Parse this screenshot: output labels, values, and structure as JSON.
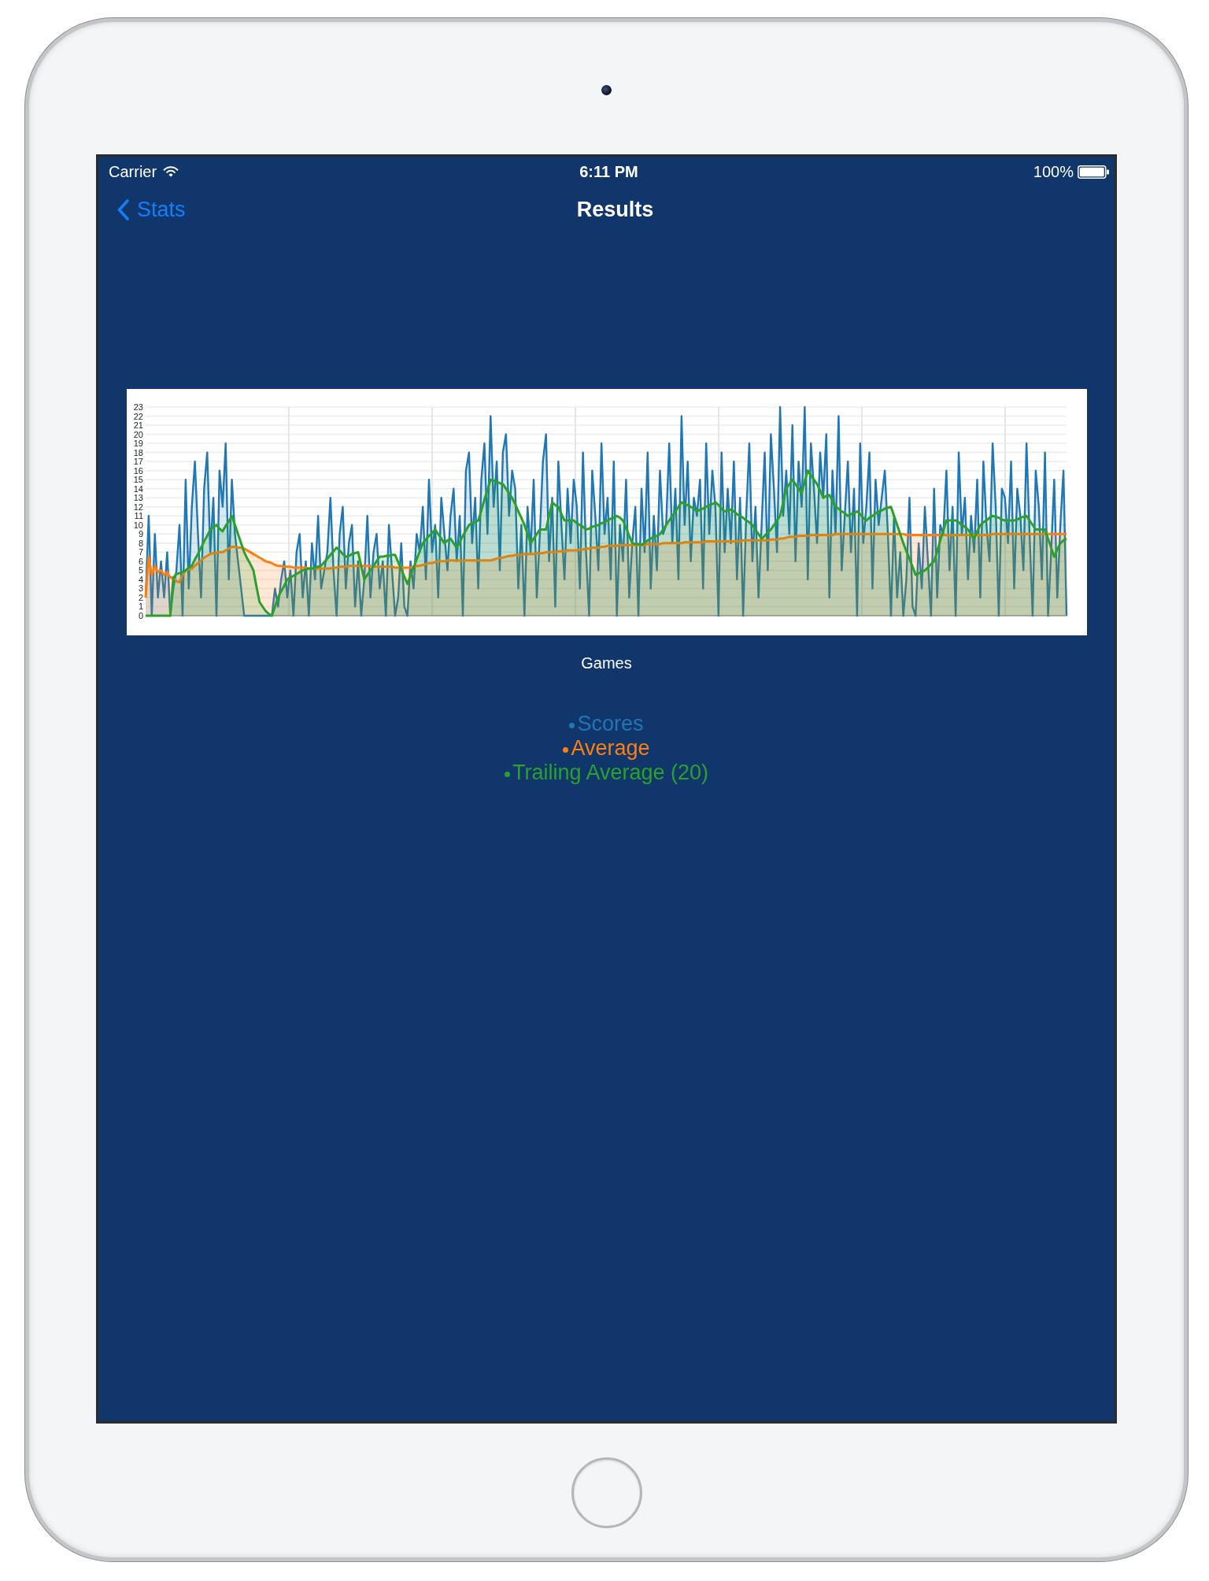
{
  "status_bar": {
    "carrier": "Carrier",
    "time": "6:11 PM",
    "battery": "100%"
  },
  "nav_bar": {
    "back_button": "Stats",
    "title": "Results"
  },
  "chart": {
    "chart_data": {
      "type": "area",
      "xlabel": "Games",
      "ylim": [
        0,
        23
      ],
      "yticks": [
        0,
        1,
        2,
        3,
        4,
        5,
        6,
        7,
        8,
        9,
        10,
        11,
        12,
        13,
        14,
        15,
        16,
        17,
        18,
        19,
        20,
        21,
        22,
        23
      ],
      "grid": true,
      "series": [
        {
          "name": "Scores",
          "color": "#1f77b4",
          "values": [
            2,
            11,
            0,
            9,
            2,
            6,
            2,
            7,
            0,
            3,
            5,
            10,
            0,
            15,
            3,
            12,
            17,
            9,
            2,
            14,
            18,
            7,
            13,
            0,
            16,
            12,
            19,
            4,
            15,
            9,
            6,
            3,
            0,
            0,
            0,
            0,
            0,
            0,
            0,
            0,
            0,
            0,
            3,
            1,
            4,
            6,
            2,
            5,
            0,
            7,
            9,
            2,
            6,
            0,
            8,
            4,
            11,
            3,
            5,
            7,
            13,
            5,
            0,
            9,
            12,
            3,
            8,
            10,
            1,
            6,
            0,
            4,
            11,
            2,
            7,
            9,
            3,
            6,
            0,
            10,
            5,
            0,
            2,
            8,
            1,
            0,
            6,
            3,
            9,
            7,
            12,
            4,
            15,
            7,
            10,
            2,
            13,
            9,
            5,
            11,
            14,
            6,
            11,
            0,
            16,
            18,
            8,
            13,
            3,
            15,
            19,
            9,
            22,
            12,
            17,
            5,
            18,
            20,
            11,
            16,
            14,
            3,
            10,
            0,
            12,
            7,
            15,
            2,
            9,
            17,
            20,
            6,
            13,
            1,
            17,
            10,
            4,
            14,
            8,
            15,
            12,
            3,
            18,
            7,
            0,
            16,
            11,
            5,
            19,
            9,
            13,
            4,
            17,
            0,
            10,
            6,
            15,
            2,
            8,
            12,
            0,
            14,
            7,
            18,
            3,
            11,
            5,
            16,
            9,
            10,
            19,
            8,
            14,
            4,
            22,
            10,
            17,
            6,
            13,
            11,
            15,
            3,
            19,
            9,
            16,
            12,
            0,
            18,
            7,
            14,
            8,
            17,
            4,
            13,
            0,
            11,
            19,
            6,
            12,
            2,
            10,
            18,
            5,
            20,
            14,
            7,
            23,
            11,
            16,
            9,
            21,
            6,
            17,
            12,
            23,
            4,
            19,
            14,
            8,
            18,
            13,
            20,
            2,
            16,
            9,
            22,
            5,
            11,
            17,
            7,
            14,
            0,
            19,
            8,
            12,
            18,
            3,
            15,
            10,
            13,
            16,
            9,
            0,
            11,
            2,
            7,
            0,
            4,
            13,
            1,
            0,
            8,
            3,
            12,
            6,
            0,
            14,
            2,
            10,
            9,
            16,
            5,
            12,
            0,
            18,
            9,
            13,
            4,
            11,
            7,
            15,
            2,
            17,
            10,
            6,
            19,
            12,
            0,
            14,
            13,
            8,
            17,
            3,
            14,
            11,
            5,
            19,
            9,
            0,
            16,
            12,
            4,
            18,
            0,
            7,
            15,
            2,
            10,
            16,
            0
          ]
        },
        {
          "name": "Average",
          "color": "#ff7f0e",
          "values": [
            2,
            6.5,
            4.5,
            5.5,
            4.8,
            5,
            4.5,
            4.8,
            4.2,
            4.2,
            3.8,
            3.7,
            4.5,
            5,
            5.1,
            5.2,
            5.5,
            5.8,
            6.1,
            6.4,
            6.6,
            6.8,
            6.9,
            6.9,
            7,
            7,
            7.2,
            7.4,
            7.6,
            7.6,
            7.5,
            7.5,
            7.4,
            7.2,
            7,
            6.8,
            6.6,
            6.4,
            6.2,
            6,
            5.9,
            5.8,
            5.6,
            5.5,
            5.5,
            5.4,
            5.4,
            5.4,
            5.3,
            5.3,
            5.3,
            5.3,
            5.3,
            5.2,
            5.2,
            5.2,
            5.2,
            5.2,
            5.2,
            5.2,
            5.2,
            5.3,
            5.3,
            5.4,
            5.4,
            5.4,
            5.5,
            5.5,
            5.5,
            5.5,
            5.5,
            5.5,
            5.5,
            5.5,
            5.4,
            5.4,
            5.4,
            5.4,
            5.4,
            5.4,
            5.4,
            5.3,
            5.3,
            5.3,
            5.3,
            5.3,
            5.3,
            5.4,
            5.5,
            5.5,
            5.6,
            5.7,
            5.8,
            5.8,
            5.9,
            6,
            6,
            6,
            6.1,
            6.1,
            6.1,
            6.1,
            6.1,
            6.1,
            6.1,
            6.1,
            6.1,
            6.1,
            6.1,
            6.1,
            6.1,
            6.1,
            6.1,
            6.2,
            6.3,
            6.4,
            6.4,
            6.5,
            6.6,
            6.6,
            6.7,
            6.7,
            6.7,
            6.8,
            6.8,
            6.8,
            6.8,
            6.9,
            6.9,
            6.9,
            7,
            7,
            7,
            7,
            7.1,
            7.1,
            7.1,
            7.2,
            7.2,
            7.2,
            7.2,
            7.3,
            7.3,
            7.4,
            7.4,
            7.5,
            7.5,
            7.5,
            7.6,
            7.6,
            7.7,
            7.7,
            7.7,
            7.7,
            7.8,
            7.8,
            7.8,
            7.8,
            7.8,
            7.8,
            7.8,
            7.8,
            7.8,
            7.9,
            7.9,
            7.9,
            7.9,
            7.9,
            8,
            8,
            8,
            8,
            8,
            8,
            8,
            8.1,
            8.1,
            8.1,
            8.1,
            8.1,
            8.1,
            8.1,
            8.2,
            8.2,
            8.2,
            8.2,
            8.2,
            8.2,
            8.2,
            8.2,
            8.2,
            8.2,
            8.2,
            8.2,
            8.3,
            8.3,
            8.3,
            8.3,
            8.3,
            8.3,
            8.3,
            8.3,
            8.3,
            8.4,
            8.4,
            8.4,
            8.5,
            8.5,
            8.6,
            8.7,
            8.7,
            8.7,
            8.8,
            8.8,
            8.8,
            8.8,
            8.9,
            8.9,
            8.9,
            8.9,
            8.9,
            8.9,
            8.9,
            8.9,
            9,
            9,
            9,
            9,
            9,
            9,
            9,
            9,
            9,
            9,
            9,
            9,
            9,
            9,
            9,
            9,
            9,
            9,
            9,
            9,
            9,
            9,
            9,
            8.9,
            8.9,
            8.9,
            8.9,
            8.9,
            8.9,
            8.9,
            8.9,
            8.9,
            8.9,
            8.9,
            8.9,
            8.9,
            8.9,
            8.9,
            8.9,
            8.9,
            8.9,
            8.9,
            8.9,
            8.9,
            8.9,
            8.9,
            8.9,
            8.9,
            8.9,
            8.9,
            8.9,
            9,
            9,
            9,
            9,
            9,
            9,
            9,
            9,
            9,
            9,
            9,
            9,
            9,
            9,
            9,
            9,
            9,
            9,
            9,
            9,
            9,
            9,
            9,
            9,
            9
          ]
        },
        {
          "name": "Trailing Average (20)",
          "color": "#2ca02c",
          "values": [
            0,
            0,
            0,
            0,
            0,
            0,
            0,
            0,
            0,
            4.2,
            4.6,
            4.7,
            4.8,
            5,
            5.3,
            5.5,
            6.2,
            6.8,
            7.5,
            8.2,
            8.8,
            9.5,
            9.8,
            10,
            9.6,
            9.3,
            9.9,
            10.4,
            11,
            10,
            9,
            8,
            7,
            6.3,
            5.7,
            5,
            3.2,
            1.5,
            1,
            0.5,
            0.2,
            0,
            1,
            2,
            2.7,
            3.3,
            4,
            4.2,
            4.4,
            4.6,
            4.8,
            5,
            5.1,
            5.2,
            5.2,
            5.3,
            5.4,
            5.5,
            5.9,
            6.3,
            6.7,
            7.1,
            7.5,
            7.2,
            6.8,
            6.5,
            6.6,
            6.8,
            6.9,
            7,
            5.5,
            4,
            4.5,
            5,
            5.5,
            6,
            6.5,
            6.5,
            6.6,
            6.6,
            6.7,
            6.7,
            5.9,
            5.1,
            4.3,
            3.5,
            4.4,
            5.3,
            6.2,
            7.1,
            8,
            8.4,
            8.8,
            9.1,
            9.5,
            9,
            8.5,
            8,
            8.3,
            8.5,
            8,
            7.5,
            8.1,
            8.8,
            9.4,
            10,
            10.2,
            10.3,
            10.5,
            11.6,
            12.8,
            13.9,
            15,
            14.9,
            14.8,
            14.6,
            14.5,
            14,
            13.5,
            13,
            12.3,
            11.5,
            10.8,
            10,
            9,
            8,
            8.5,
            9,
            9.5,
            9.5,
            9.5,
            11,
            12.5,
            12.2,
            12,
            11.2,
            10.5,
            10.5,
            10.5,
            10.5,
            10.2,
            10,
            9.8,
            9.5,
            9.6,
            9.8,
            9.9,
            10,
            10.2,
            10.3,
            10.5,
            10.7,
            10.8,
            11,
            10.8,
            10.5,
            9.7,
            8.8,
            8,
            7.9,
            7.9,
            7.8,
            8,
            8.3,
            8.5,
            8.7,
            8.8,
            9,
            9.5,
            10,
            10.5,
            11,
            11.5,
            12,
            12.5,
            12.3,
            12.2,
            12,
            11.8,
            11.5,
            11.7,
            11.8,
            12,
            12.2,
            12.3,
            12.5,
            12.2,
            11.8,
            11.5,
            11.6,
            11.7,
            11.5,
            11.2,
            11,
            10.8,
            10.5,
            10.3,
            10,
            9.5,
            9,
            8.5,
            8.8,
            9.2,
            9.5,
            10,
            10.5,
            11,
            12.5,
            14,
            14.5,
            15,
            14.5,
            14,
            13.5,
            14.8,
            16,
            15.5,
            15,
            14.5,
            13.8,
            13,
            13.2,
            13.3,
            12.7,
            12,
            11.8,
            11.5,
            11.3,
            11,
            11.2,
            11.3,
            11.5,
            11.2,
            10.8,
            10.5,
            10.8,
            11,
            11.3,
            11.5,
            11.6,
            11.8,
            11.9,
            12,
            11,
            10,
            9,
            8,
            7.1,
            6.3,
            5.4,
            4.5,
            4.7,
            4.8,
            5,
            5.3,
            5.7,
            6,
            7.1,
            8.3,
            9.4,
            10.5,
            10.5,
            10.5,
            10.5,
            10.3,
            10,
            9.8,
            9.5,
            9,
            8.5,
            9.3,
            10,
            10.3,
            10.5,
            10.8,
            11,
            10.9,
            10.8,
            10.6,
            10.5,
            10.5,
            10.5,
            10.5,
            10.6,
            10.8,
            10.9,
            11,
            10.5,
            10,
            9.5,
            9.5,
            9.5,
            9.5,
            8.5,
            7.5,
            6.5,
            7.3,
            8,
            8.3,
            8.5
          ]
        }
      ]
    }
  }
}
